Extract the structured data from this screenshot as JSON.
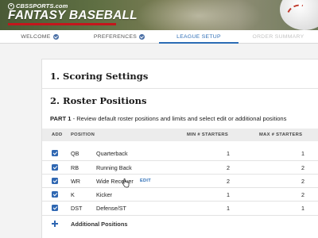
{
  "header": {
    "brand": "CBSSPORTS.com",
    "title": "FANTASY BASEBALL"
  },
  "nav": {
    "tabs": [
      {
        "label": "WELCOME",
        "state": "completed"
      },
      {
        "label": "PREFERENCES",
        "state": "completed"
      },
      {
        "label": "LEAGUE SETUP",
        "state": "active"
      },
      {
        "label": "ORDER SUMMARY",
        "state": "disabled"
      }
    ]
  },
  "content": {
    "section1_title": "1. Scoring Settings",
    "section2_title": "2. Roster Positions",
    "part_label": "PART 1",
    "part_text": " - Review default roster positions and limits and select edit or additional positions",
    "table": {
      "headers": {
        "add": "ADD",
        "position": "POSITION",
        "min": "MIN # STARTERS",
        "max": "MAX # STARTERS"
      },
      "rows": [
        {
          "abbr": "QB",
          "name": "Quarterback",
          "min": "1",
          "max": "1",
          "checked": true
        },
        {
          "abbr": "RB",
          "name": "Running Back",
          "min": "2",
          "max": "2",
          "checked": true
        },
        {
          "abbr": "WR",
          "name": "Wide Receiver",
          "min": "2",
          "max": "2",
          "checked": true,
          "edit": "EDIT"
        },
        {
          "abbr": "K",
          "name": "Kicker",
          "min": "1",
          "max": "2",
          "checked": true
        },
        {
          "abbr": "DST",
          "name": "Defense/ST",
          "min": "1",
          "max": "1",
          "checked": true
        }
      ],
      "add_positions": "Additional Positions"
    }
  },
  "colors": {
    "accent": "#2b6cb5",
    "checkbox": "#2f67b2",
    "logo_stripe": "#c4161c"
  }
}
